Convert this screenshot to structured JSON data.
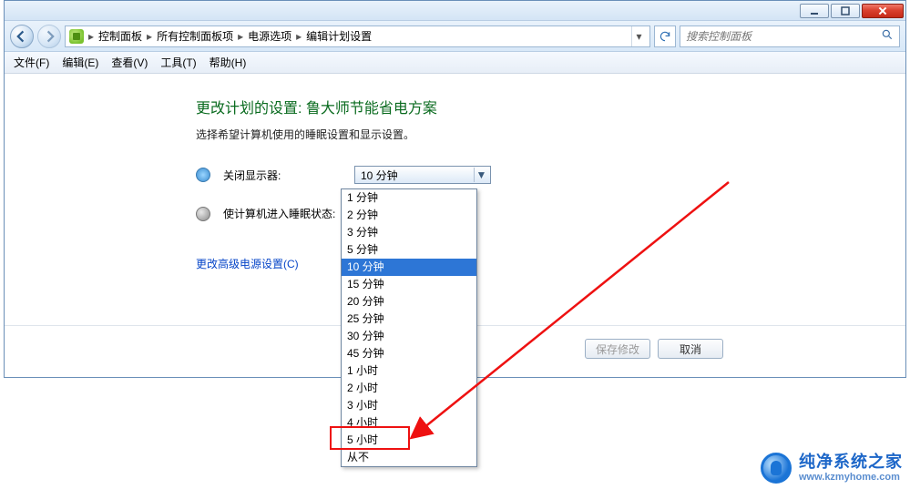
{
  "breadcrumb": [
    "控制面板",
    "所有控制面板项",
    "电源选项",
    "编辑计划设置"
  ],
  "search": {
    "placeholder": "搜索控制面板"
  },
  "menus": {
    "file": "文件(F)",
    "edit": "编辑(E)",
    "view": "查看(V)",
    "tools": "工具(T)",
    "help": "帮助(H)"
  },
  "page": {
    "title": "更改计划的设置: 鲁大师节能省电方案",
    "subtitle": "选择希望计算机使用的睡眠设置和显示设置。",
    "row_display": "关闭显示器:",
    "row_sleep": "使计算机进入睡眠状态:",
    "advanced_link": "更改高级电源设置(C)",
    "save_btn": "保存修改",
    "cancel_btn": "取消"
  },
  "combo": {
    "selected": "10 分钟",
    "options": [
      "1 分钟",
      "2 分钟",
      "3 分钟",
      "5 分钟",
      "10 分钟",
      "15 分钟",
      "20 分钟",
      "25 分钟",
      "30 分钟",
      "45 分钟",
      "1 小时",
      "2 小时",
      "3 小时",
      "4 小时",
      "5 小时",
      "从不"
    ],
    "selected_index": 4
  },
  "watermark": {
    "name": "纯净系统之家",
    "url": "www.kzmyhome.com"
  }
}
